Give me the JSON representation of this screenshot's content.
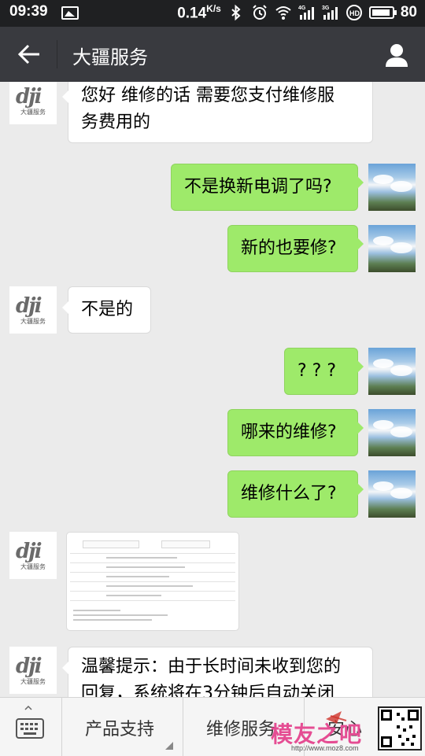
{
  "status_bar": {
    "time": "09:39",
    "speed": "0.14",
    "speed_unit": "K/s",
    "battery": "80",
    "network_labels": [
      "4G",
      "3G"
    ]
  },
  "header": {
    "title": "大疆服务"
  },
  "dji_avatar": {
    "logo": "dji",
    "subtitle": "大疆服务"
  },
  "messages": [
    {
      "side": "left",
      "text": "您好 维修的话 需要您支付维修服务费用的"
    },
    {
      "side": "right",
      "text": "不是换新电调了吗?"
    },
    {
      "side": "right",
      "text": "新的也要修?"
    },
    {
      "side": "left",
      "text": "不是的"
    },
    {
      "side": "right",
      "text": "? ? ?"
    },
    {
      "side": "right",
      "text": "哪来的维修?"
    },
    {
      "side": "right",
      "text": "维修什么了?"
    },
    {
      "side": "left",
      "type": "image",
      "text": ""
    },
    {
      "side": "left",
      "text": "温馨提示：由于长时间未收到您的回复，系统将在3分钟后自动关闭"
    }
  ],
  "bubble_lines": {
    "m0": [
      "您好 维修的话 需要您支付维修服",
      "务费用的"
    ],
    "m8": [
      "温馨提示：由于长时间未收到您的",
      "回复，系统将在3分钟后自动关闭"
    ]
  },
  "bottom_menu": {
    "items": [
      "产品支持",
      "维修服务",
      "安心"
    ]
  },
  "watermark": {
    "text": "模友之吧",
    "url": "http://www.moz8.com"
  },
  "colors": {
    "header_bg": "#393a3f",
    "statusbar_bg": "#1f2022",
    "chat_bg": "#ebebeb",
    "bubble_right": "#9eea6a",
    "bubble_left": "#ffffff"
  }
}
